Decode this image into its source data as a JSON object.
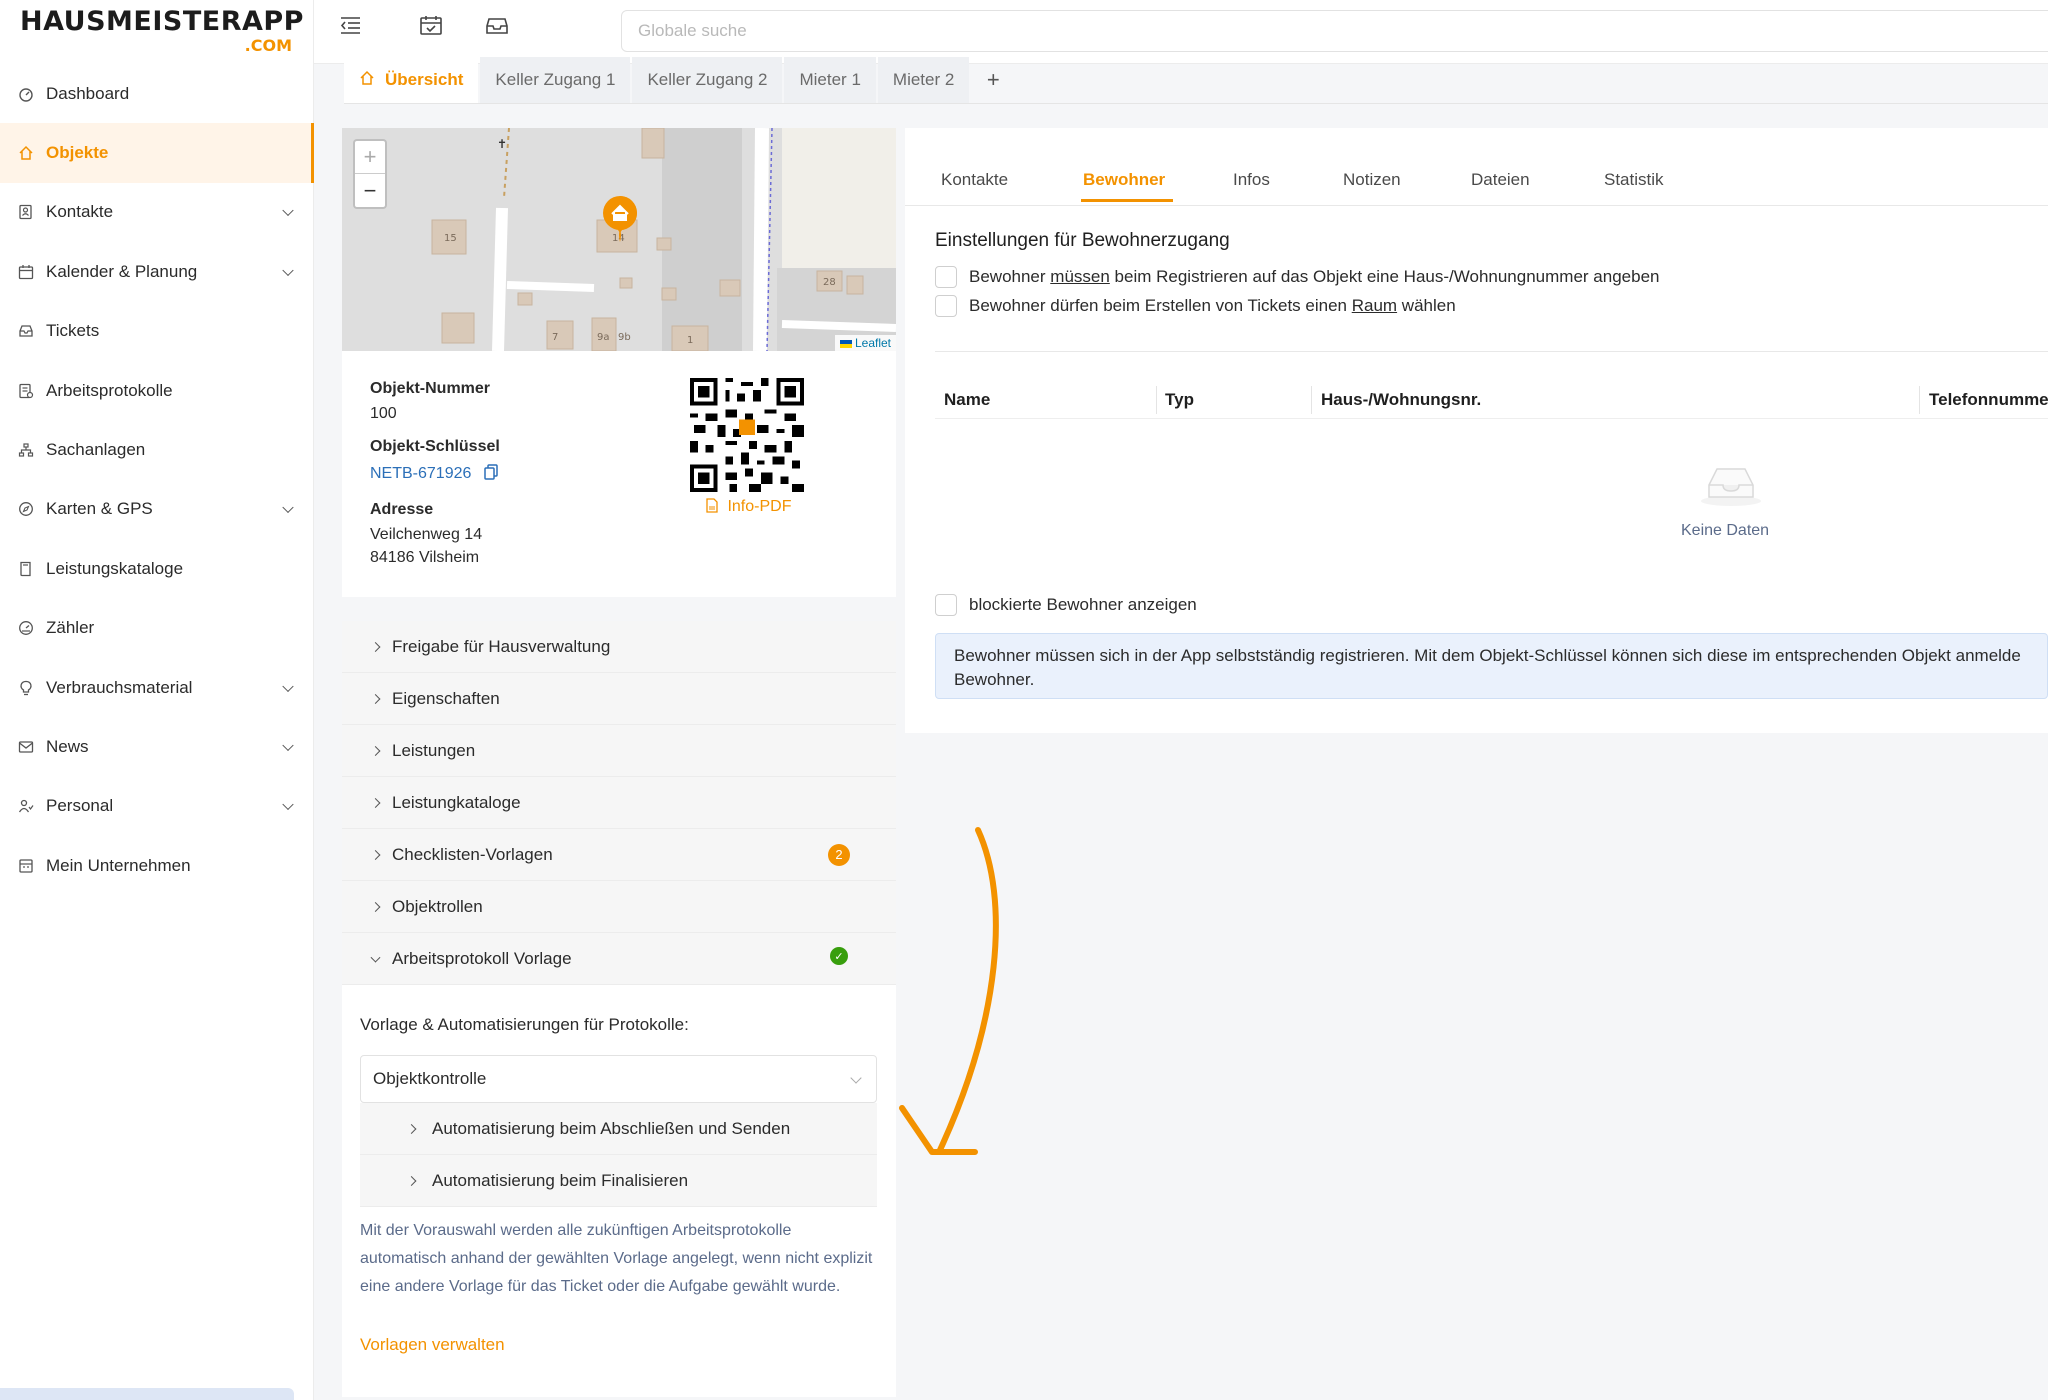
{
  "app": {
    "logo_main": "HAUSMEISTERAPP",
    "logo_sub": ".COM",
    "accent": "#f39200"
  },
  "sidebar": {
    "items": [
      {
        "label": "Dashboard",
        "icon": "dashboard-icon",
        "has_submenu": false,
        "active": false
      },
      {
        "label": "Objekte",
        "icon": "home-icon",
        "has_submenu": false,
        "active": true
      },
      {
        "label": "Kontakte",
        "icon": "contacts-icon",
        "has_submenu": true,
        "active": false
      },
      {
        "label": "Kalender & Planung",
        "icon": "calendar-icon",
        "has_submenu": true,
        "active": false
      },
      {
        "label": "Tickets",
        "icon": "ticket-icon",
        "has_submenu": false,
        "active": false
      },
      {
        "label": "Arbeitsprotokolle",
        "icon": "protocol-icon",
        "has_submenu": false,
        "active": false
      },
      {
        "label": "Sachanlagen",
        "icon": "assets-icon",
        "has_submenu": false,
        "active": false
      },
      {
        "label": "Karten & GPS",
        "icon": "compass-icon",
        "has_submenu": true,
        "active": false
      },
      {
        "label": "Leistungskataloge",
        "icon": "catalog-icon",
        "has_submenu": false,
        "active": false
      },
      {
        "label": "Zähler",
        "icon": "meter-icon",
        "has_submenu": false,
        "active": false
      },
      {
        "label": "Verbrauchsmaterial",
        "icon": "bulb-icon",
        "has_submenu": true,
        "active": false
      },
      {
        "label": "News",
        "icon": "mail-icon",
        "has_submenu": true,
        "active": false
      },
      {
        "label": "Personal",
        "icon": "people-icon",
        "has_submenu": true,
        "active": false
      },
      {
        "label": "Mein Unternehmen",
        "icon": "company-icon",
        "has_submenu": false,
        "active": false
      }
    ]
  },
  "topbar": {
    "search_placeholder": "Globale suche"
  },
  "object_tabs": [
    "Übersicht",
    "Keller Zugang 1",
    "Keller Zugang 2",
    "Mieter 1",
    "Mieter 2"
  ],
  "object_tabs_add": "+",
  "map": {
    "zoom_in": "+",
    "zoom_out": "−",
    "attribution": "Leaflet",
    "house_numbers": [
      "15",
      "14",
      "28",
      "7",
      "9a",
      "9b",
      "1"
    ]
  },
  "object": {
    "number_label": "Objekt-Nummer",
    "number": "100",
    "key_label": "Objekt-Schlüssel",
    "key": "NETB-671926",
    "address_label": "Adresse",
    "street": "Veilchenweg 14",
    "city": "84186 Vilsheim",
    "pdf_label": "Info-PDF"
  },
  "sections": [
    {
      "label": "Freigabe für Hausverwaltung"
    },
    {
      "label": "Eigenschaften"
    },
    {
      "label": "Leistungen"
    },
    {
      "label": "Leistungkataloge"
    },
    {
      "label": "Checklisten-Vorlagen",
      "badge": "2"
    },
    {
      "label": "Objektrollen"
    },
    {
      "label": "Arbeitsprotokoll Vorlage",
      "open": true,
      "check": "✓"
    }
  ],
  "template": {
    "label": "Vorlage & Automatisierungen für Protokolle:",
    "selected": "Objektkontrolle",
    "sub_items": [
      "Automatisierung beim Abschließen und Senden",
      "Automatisierung beim Finalisieren"
    ],
    "description": "Mit der Vorauswahl werden alle zukünftigen Arbeitsprotokolle automatisch anhand der gewählten Vorlage angelegt, wenn nicht explizit eine andere Vorlage für das Ticket oder die Aufgabe gewählt wurde.",
    "manage_link": "Vorlagen verwalten"
  },
  "right_tabs": [
    "Kontakte",
    "Bewohner",
    "Infos",
    "Notizen",
    "Dateien",
    "Statistik"
  ],
  "residents": {
    "heading": "Einstellungen für Bewohnerzugang",
    "opt1_a": "Bewohner ",
    "opt1_u": "müssen",
    "opt1_b": " beim Registrieren auf das Objekt eine Haus-/Wohnungnummer angeben",
    "opt2_a": "Bewohner dürfen beim Erstellen von Tickets einen ",
    "opt2_u": "Raum",
    "opt2_b": " wählen",
    "columns": [
      "Name",
      "Typ",
      "Haus-/Wohnungsnr.",
      "Telefonnumme"
    ],
    "empty": "Keine Daten",
    "show_blocked": "blockierte Bewohner anzeigen",
    "alert": "Bewohner müssen sich in der App selbstständig registrieren. Mit dem Objekt-Schlüssel können sich diese im entsprechenden Objekt anmelde Bewohner."
  }
}
